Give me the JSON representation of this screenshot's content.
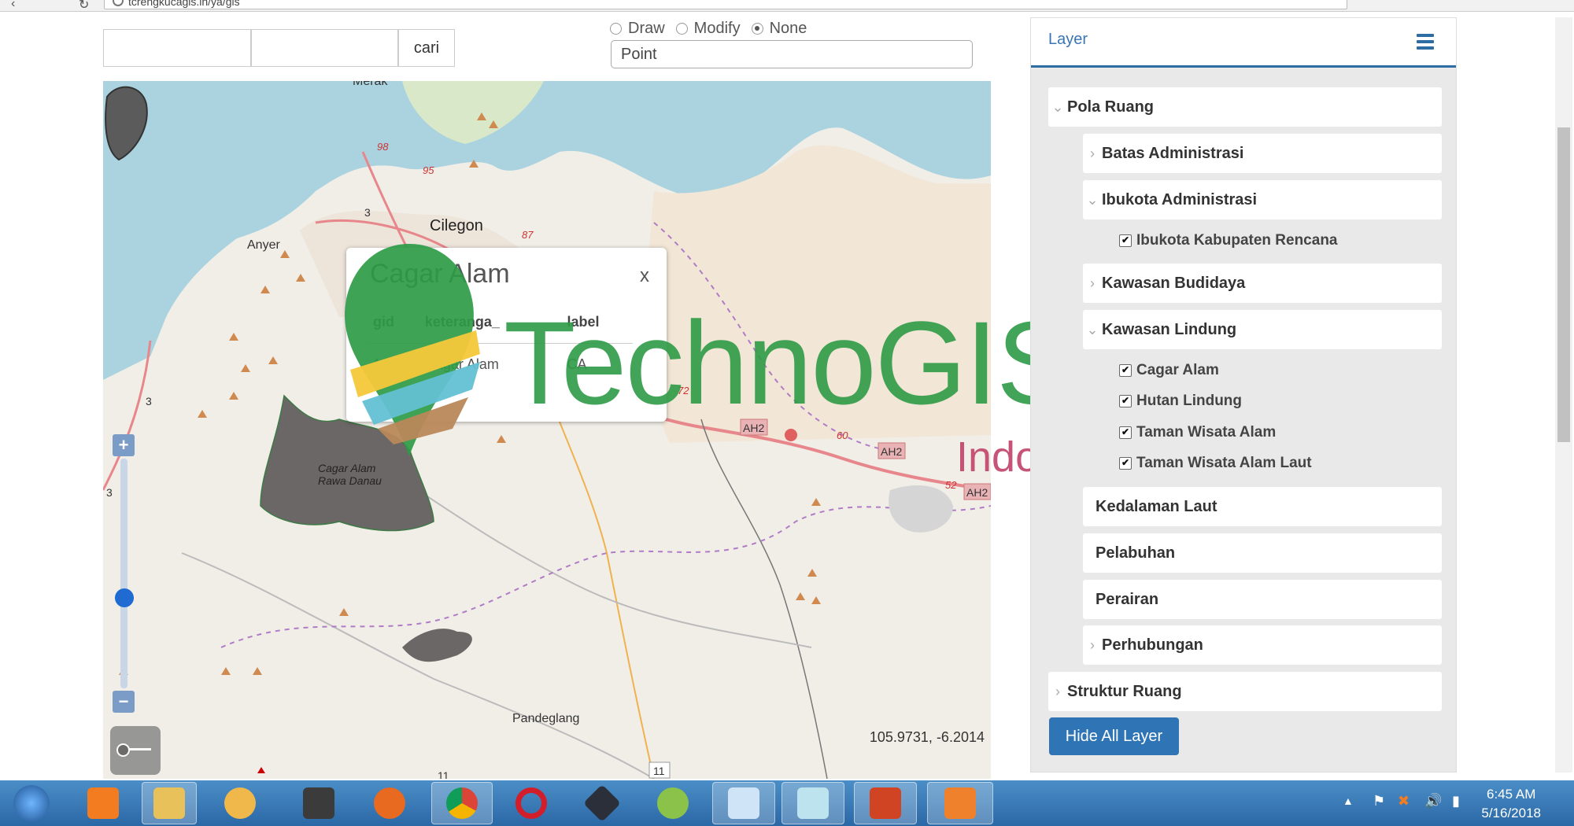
{
  "browser": {
    "url": "tcrengkucagis.in/ya/gis"
  },
  "search": {
    "input1_value": "",
    "input2_value": "",
    "button_label": "cari"
  },
  "draw": {
    "modes": [
      {
        "label": "Draw",
        "selected": false
      },
      {
        "label": "Modify",
        "selected": false
      },
      {
        "label": "None",
        "selected": true
      }
    ],
    "geometry_selected": "Point"
  },
  "map": {
    "labels": {
      "merak": "Merak",
      "cilegon": "Cilegon",
      "anyer": "Anyer",
      "pandeglang": "Pandeglang",
      "cagar_alam_rawa_danau_1": "Cagar Alam",
      "cagar_alam_rawa_danau_2": "Rawa Danau",
      "ah2_a": "AH2",
      "ah2_b": "AH2",
      "ah2_c": "AH2",
      "road_98": "98",
      "road_95": "95",
      "road_87": "87",
      "road_3a": "3",
      "road_3b": "3",
      "road_3c": "3",
      "road_72": "72",
      "road_60": "60",
      "road_52": "52",
      "road_11a": "11",
      "road_11b": "11"
    },
    "coordinates": "105.9731, -6.2014",
    "zoom_plus": "+",
    "zoom_minus": "−"
  },
  "popup": {
    "title": "Cagar Alam",
    "close": "x",
    "columns": [
      "gid",
      "keteranga_",
      "label"
    ],
    "rows": [
      [
        "1",
        "Cagar Alam",
        "CA"
      ]
    ]
  },
  "watermark": {
    "title": "TechnoGIS",
    "subtitle": "Indonesia"
  },
  "layer_panel": {
    "title": "Layer",
    "groups": [
      {
        "label": "Pola Ruang"
      },
      {
        "label": "Batas Administrasi"
      },
      {
        "label": "Ibukota Administrasi"
      },
      {
        "label": "Ibukota Kabupaten Rencana"
      },
      {
        "label": "Kawasan Budidaya"
      },
      {
        "label": "Kawasan Lindung"
      },
      {
        "label": "Cagar Alam"
      },
      {
        "label": "Hutan Lindung"
      },
      {
        "label": "Taman Wisata Alam"
      },
      {
        "label": "Taman Wisata Alam Laut"
      },
      {
        "label": "Kedalaman Laut"
      },
      {
        "label": "Pelabuhan"
      },
      {
        "label": "Perairan"
      },
      {
        "label": "Perhubungan"
      },
      {
        "label": "Struktur Ruang"
      }
    ],
    "hide_all_label": "Hide All Layer"
  },
  "taskbar": {
    "time": "6:45 AM",
    "date": "5/16/2018"
  }
}
